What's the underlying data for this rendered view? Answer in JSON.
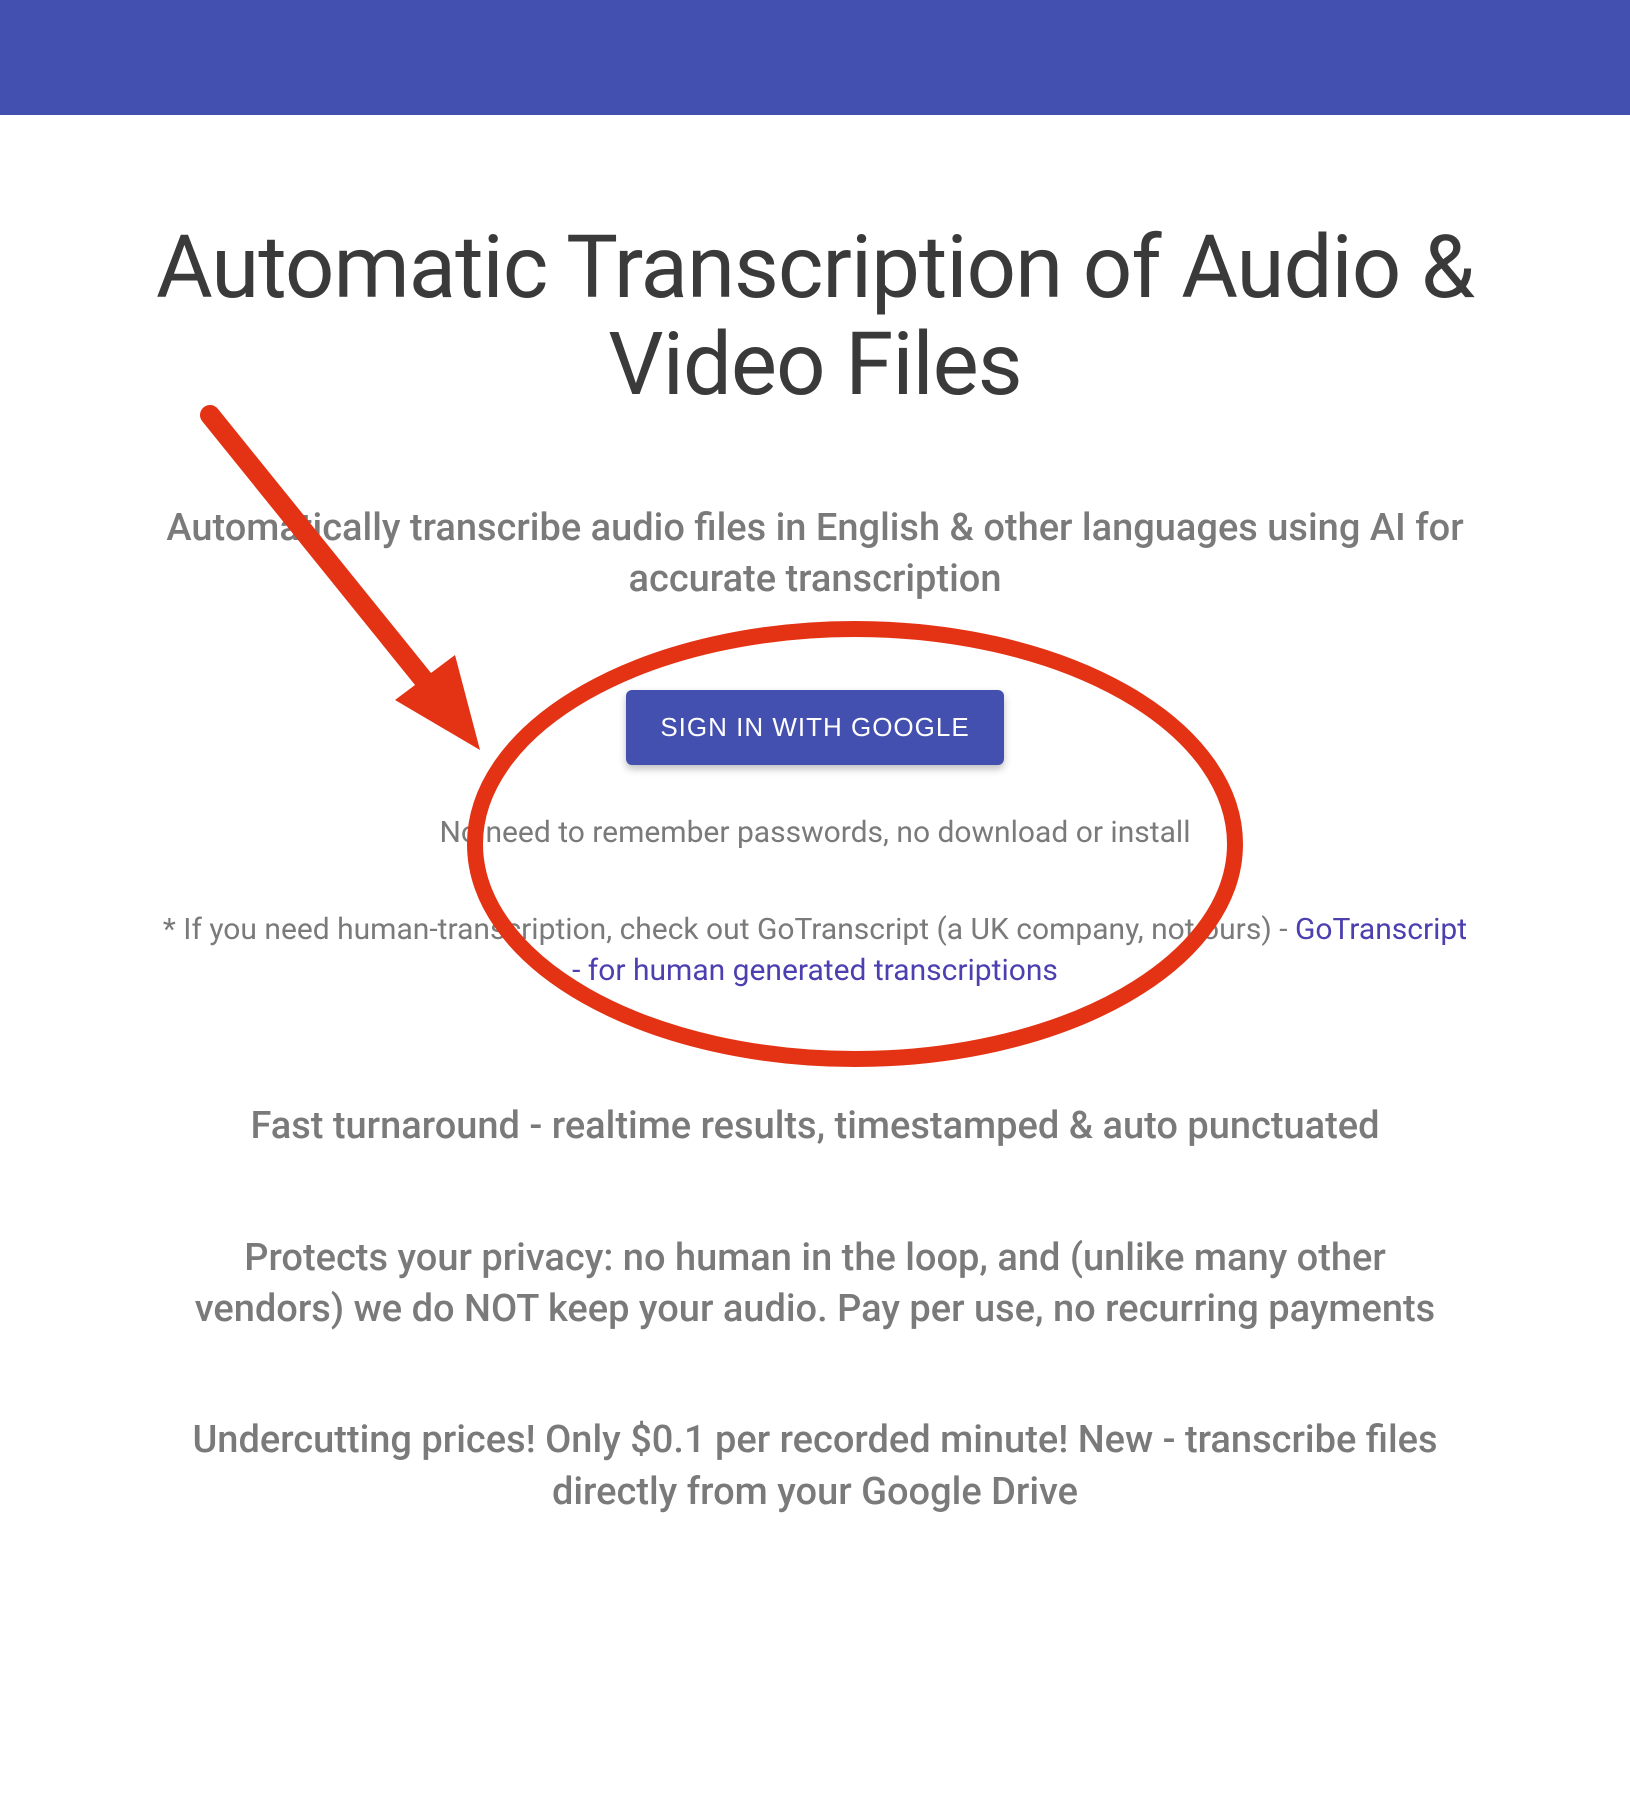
{
  "header": {},
  "main": {
    "title": "Automatic Transcription of Audio & Video Files",
    "subtitle": "Automatically transcribe audio files in English & other languages using AI for accurate transcription",
    "signin_button_label": "SIGN IN WITH GOOGLE",
    "no_password_note": "No need to remember passwords, no download or install",
    "human_transcript_prefix": "* If you need human-transcription, check out GoTranscript (a UK company, not ours) - ",
    "human_transcript_link": "GoTranscript - for human generated transcriptions",
    "features": [
      "Fast turnaround - realtime results, timestamped & auto punctuated",
      "Protects your privacy: no human in the loop, and (unlike many other vendors) we do NOT keep your audio. Pay per use, no recurring payments",
      "Undercutting prices! Only $0.1 per recorded minute! New - transcribe files directly from your Google Drive"
    ]
  },
  "annotation": {
    "arrow_color": "#e43314",
    "circle_color": "#e43314"
  }
}
